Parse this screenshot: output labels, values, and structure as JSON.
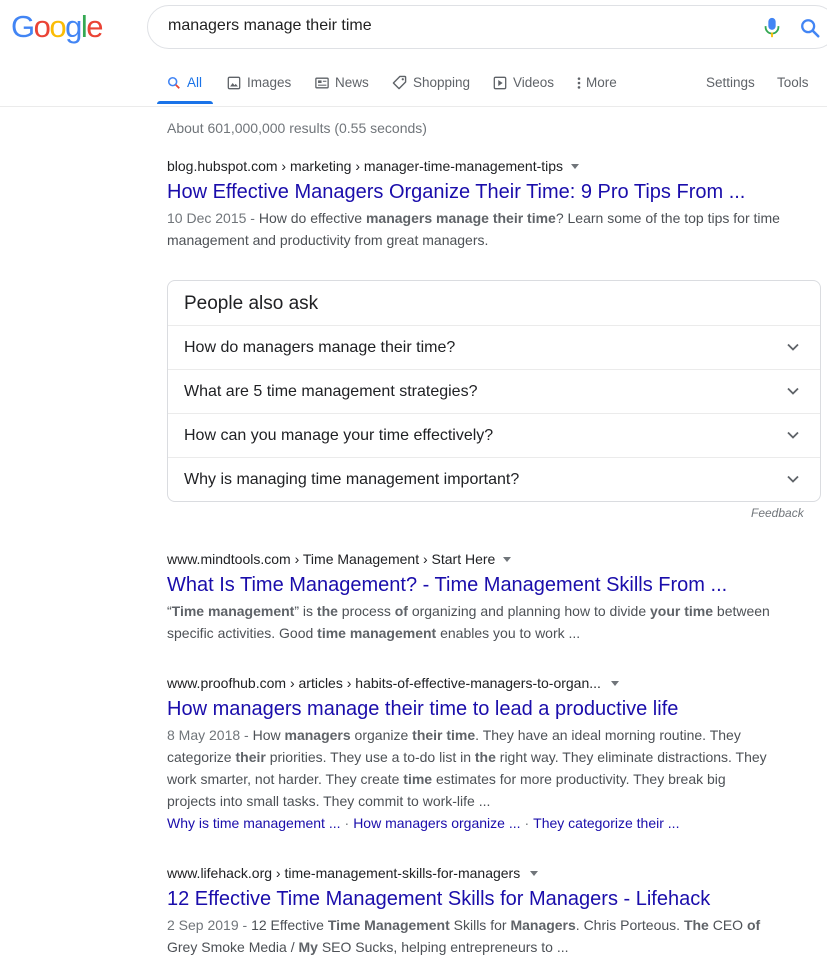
{
  "logo": {
    "letters": [
      "G",
      "o",
      "o",
      "g",
      "l",
      "e"
    ],
    "colors": [
      "#4285f4",
      "#ea4335",
      "#fbbc05",
      "#4285f4",
      "#34a853",
      "#ea4335"
    ]
  },
  "search": {
    "query": "managers manage their time"
  },
  "tabs": [
    {
      "label": "All",
      "icon": "search-icon"
    },
    {
      "label": "Images",
      "icon": "image-icon"
    },
    {
      "label": "News",
      "icon": "news-icon"
    },
    {
      "label": "Shopping",
      "icon": "tag-icon"
    },
    {
      "label": "Videos",
      "icon": "play-icon"
    },
    {
      "label": "More",
      "icon": "more-vert-icon"
    }
  ],
  "tools": {
    "settings": "Settings",
    "tools": "Tools"
  },
  "stats": "About 601,000,000 results (0.55 seconds)",
  "results": [
    {
      "cite": "blog.hubspot.com › marketing › manager-time-management-tips",
      "title": "How Effective Managers Organize Their Time: 9 Pro Tips From ...",
      "snippet_parts": [
        {
          "t": "10 Dec 2015 - ",
          "s": "date"
        },
        {
          "t": "How do effective ",
          "s": ""
        },
        {
          "t": "managers manage their time",
          "s": "b"
        },
        {
          "t": "? Learn some of the top tips for time management and productivity from great managers.",
          "s": ""
        }
      ]
    },
    {
      "cite": "www.mindtools.com › Time Management › Start Here",
      "title": "What Is Time Management? - Time Management Skills From ...",
      "snippet_parts": [
        {
          "t": "“",
          "s": ""
        },
        {
          "t": "Time management",
          "s": "b"
        },
        {
          "t": "” is ",
          "s": ""
        },
        {
          "t": "the",
          "s": "b"
        },
        {
          "t": " process ",
          "s": ""
        },
        {
          "t": "of",
          "s": "b"
        },
        {
          "t": " organizing and planning how to divide ",
          "s": ""
        },
        {
          "t": "your time",
          "s": "b"
        },
        {
          "t": " between specific activities. Good ",
          "s": ""
        },
        {
          "t": "time management",
          "s": "b"
        },
        {
          "t": " enables you to work ...",
          "s": ""
        }
      ]
    },
    {
      "cite": "www.proofhub.com › articles › habits-of-effective-managers-to-organ...",
      "title": "How managers manage their time to lead a productive life",
      "snippet_parts": [
        {
          "t": "8 May 2018 - ",
          "s": "date"
        },
        {
          "t": "How ",
          "s": ""
        },
        {
          "t": "managers",
          "s": "b"
        },
        {
          "t": " organize ",
          "s": ""
        },
        {
          "t": "their time",
          "s": "b"
        },
        {
          "t": ". They have an ideal morning routine. They categorize ",
          "s": ""
        },
        {
          "t": "their",
          "s": "b"
        },
        {
          "t": " priorities. They use a to-do list in ",
          "s": ""
        },
        {
          "t": "the",
          "s": "b"
        },
        {
          "t": " right way. They eliminate distractions. They work smarter, not harder. They create ",
          "s": ""
        },
        {
          "t": "time",
          "s": "b"
        },
        {
          "t": " estimates for more productivity. They break big projects into small tasks. They commit to work-life ...",
          "s": ""
        }
      ],
      "sitelinks": [
        "Why is time management ...",
        "How managers organize ...",
        "They categorize their ..."
      ]
    },
    {
      "cite": "www.lifehack.org › time-management-skills-for-managers",
      "title": "12 Effective Time Management Skills for Managers - Lifehack",
      "snippet_parts": [
        {
          "t": "2 Sep 2019 - ",
          "s": "date"
        },
        {
          "t": "12 Effective ",
          "s": ""
        },
        {
          "t": "Time Management",
          "s": "b"
        },
        {
          "t": " Skills for ",
          "s": ""
        },
        {
          "t": "Managers",
          "s": "b"
        },
        {
          "t": ". Chris Porteous. ",
          "s": ""
        },
        {
          "t": "The",
          "s": "b"
        },
        {
          "t": " CEO ",
          "s": ""
        },
        {
          "t": "of",
          "s": "b"
        },
        {
          "t": " Grey Smoke Media / ",
          "s": ""
        },
        {
          "t": "My",
          "s": "b"
        },
        {
          "t": " SEO Sucks, helping entrepreneurs to ...",
          "s": ""
        }
      ]
    }
  ],
  "paa": {
    "title": "People also ask",
    "questions": [
      "How do managers manage their time?",
      "What are 5 time management strategies?",
      "How can you manage your time effectively?",
      "Why is managing time management important?"
    ],
    "feedback": "Feedback"
  }
}
